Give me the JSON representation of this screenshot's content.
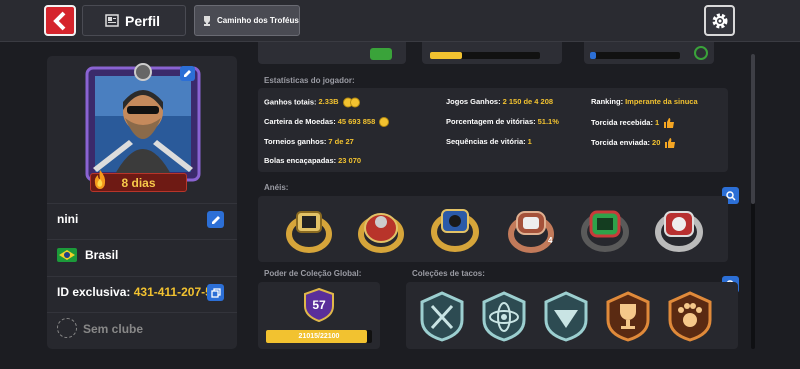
{
  "header": {
    "tab_perfil": "Perfil",
    "tab_trofeus": "Caminho dos Troféus"
  },
  "profile": {
    "days": "8 dias",
    "name": "nini",
    "country": "Brasil",
    "id_label": "ID exclusiva:",
    "id_value": "431-411-207-5",
    "club": "Sem clube"
  },
  "stats": {
    "title": "Estatísticas do jogador:",
    "ganhos_label": "Ganhos totais:",
    "ganhos_value": "2.33B",
    "carteira_label": "Carteira de Moedas:",
    "carteira_value": "45 693 858",
    "torneios_label": "Torneios ganhos:",
    "torneios_value": "7 de 27",
    "bolas_label": "Bolas encaçapadas:",
    "bolas_value": "23 070",
    "jogos_label": "Jogos Ganhos:",
    "jogos_value": "2 150 de 4 208",
    "porc_label": "Porcentagem de vitórias:",
    "porc_value": "51.1%",
    "seq_label": "Sequências de vitória:",
    "seq_value": "1",
    "ranking_label": "Ranking:",
    "ranking_value": "Imperante da sinuca",
    "torcida_rec_label": "Torcida recebida:",
    "torcida_rec_value": "1",
    "torcida_env_label": "Torcida enviada:",
    "torcida_env_value": "20"
  },
  "rings": {
    "title": "Anéis:",
    "count_badge": "4"
  },
  "power": {
    "title": "Poder de Coleção Global:",
    "level": "57",
    "progress_text": "21015/22100",
    "progress_fraction": 0.951
  },
  "cues": {
    "title": "Coleções de tacos:"
  },
  "colors": {
    "accent_blue": "#2c6fd6",
    "gold": "#f2c230",
    "red": "#d5242c"
  }
}
